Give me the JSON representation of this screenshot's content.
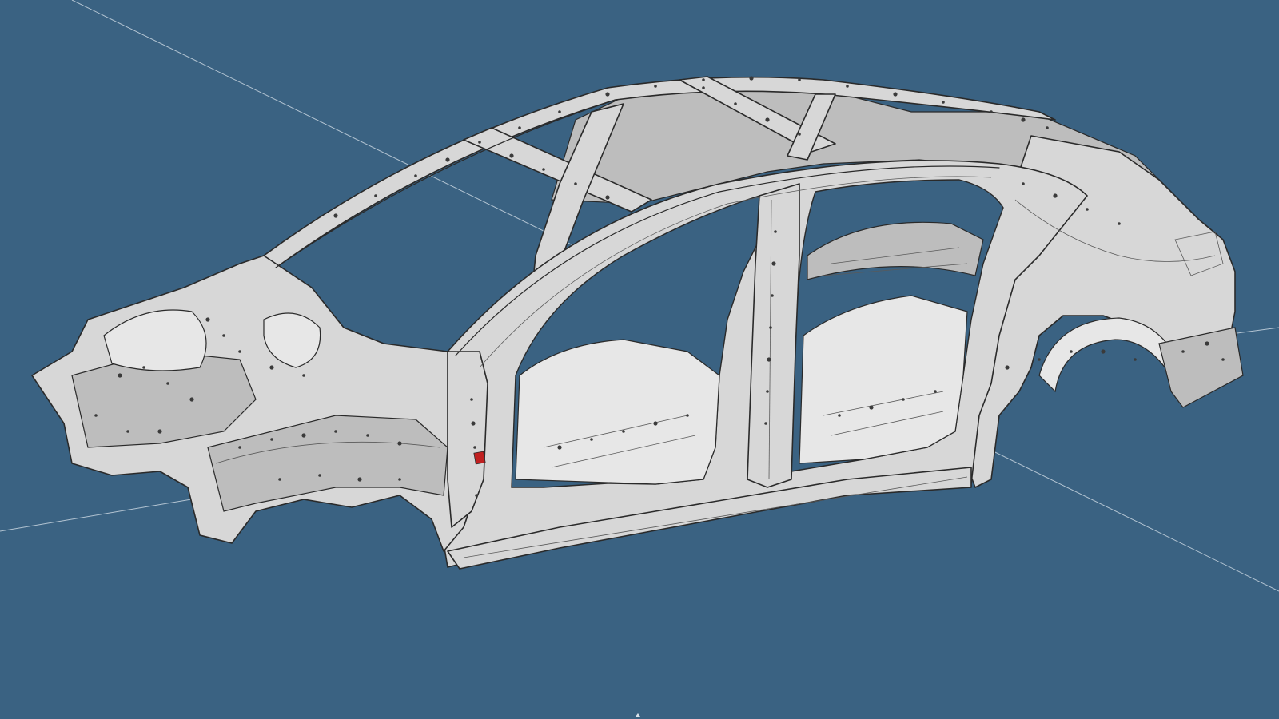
{
  "viewport": {
    "background_color": "#3a6282",
    "model_color": "#d7d7d7",
    "edge_color": "#2a2a2a",
    "accent_color": "#c02020",
    "axis_color": "#c9d6e1"
  },
  "model": {
    "icon": "car-body-in-white-icon",
    "parts": [
      "roof-rail",
      "roof-crossmember-front",
      "roof-crossmember-rear",
      "a-pillar",
      "b-pillar",
      "c-pillar",
      "rocker-panel",
      "floor-pan",
      "front-rails",
      "front-crash-structure",
      "rear-quarter-panel",
      "rear-wheel-arch",
      "rear-crash-structure"
    ]
  },
  "marker": {
    "icon": "triangle-marker-icon"
  }
}
